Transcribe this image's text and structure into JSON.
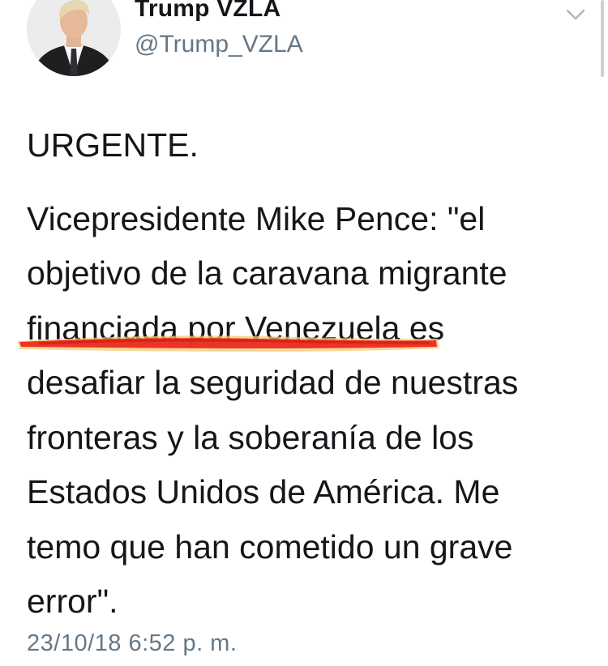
{
  "tweet": {
    "author": {
      "display_name": "Trump VZLA",
      "handle": "@Trump_VZLA",
      "avatar_icon": "profile-photo"
    },
    "more_icon": "chevron-down-icon",
    "text_lines": [
      "URGENTE.",
      "Vicepresidente Mike Pence: \"el",
      "objetivo de la caravana migrante",
      "financiada por Venezuela es",
      "desafiar la seguridad de nuestras",
      "fronteras y la soberanía de los",
      "Estados Unidos de América. Me",
      "temo que han cometido un grave",
      "error\"."
    ],
    "highlighted_phrase": "financiada por Venezuela",
    "highlight_color": "#e8231c",
    "timestamp": "23/10/18 6:52 p. m."
  },
  "colors": {
    "text": "#14171a",
    "secondary_text": "#657786",
    "background": "#ffffff"
  }
}
